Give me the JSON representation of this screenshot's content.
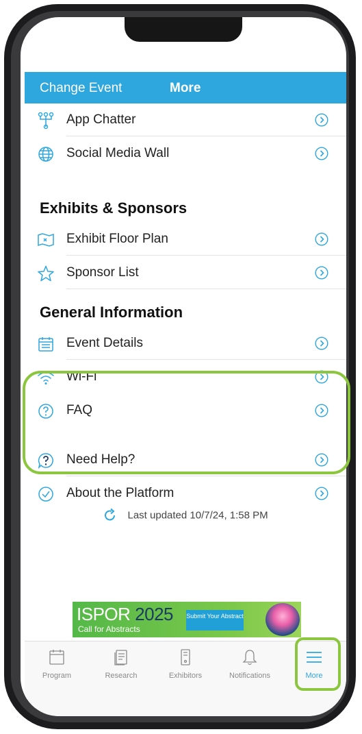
{
  "header": {
    "change_event": "Change Event",
    "title": "More"
  },
  "sections": {
    "exhibits": "Exhibits & Sponsors",
    "general": "General Information"
  },
  "rows": {
    "app_chatter": "App Chatter",
    "social_media_wall": "Social Media Wall",
    "exhibit_floor_plan": "Exhibit Floor Plan",
    "sponsor_list": "Sponsor List",
    "event_details": "Event Details",
    "wifi": "Wi-Fi",
    "faq": "FAQ",
    "need_help": "Need Help?",
    "about_platform": "About the Platform"
  },
  "last_updated": "Last updated 10/7/24, 1:58 PM",
  "banner": {
    "brand": "ISPOR",
    "year": "2025",
    "subtitle": "Call for Abstracts",
    "cta": "Submit Your Abstract"
  },
  "tabs": {
    "program": "Program",
    "research": "Research",
    "exhibitors": "Exhibitors",
    "notifications": "Notifications",
    "more": "More"
  },
  "colors": {
    "accent": "#2ea6de",
    "highlight": "#8cc63f",
    "banner_green": "#54b848"
  }
}
